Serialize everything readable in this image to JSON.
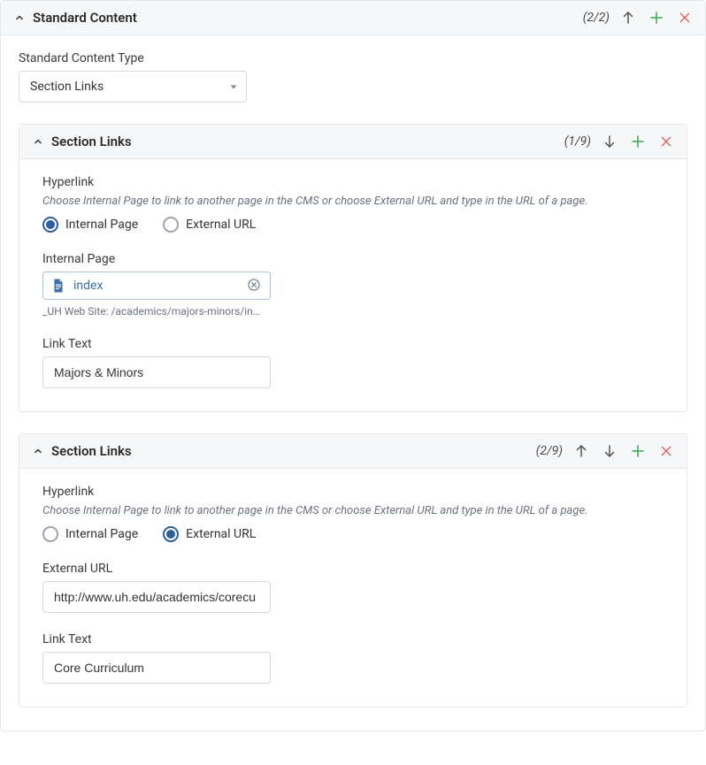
{
  "standard_content": {
    "title": "Standard Content",
    "count": "(2/2)",
    "type_label": "Standard Content Type",
    "type_value": "Section Links"
  },
  "section_links": [
    {
      "title": "Section Links",
      "count": "(1/9)",
      "show_up": false,
      "show_down": true,
      "hyperlink_label": "Hyperlink",
      "hyperlink_help": "Choose Internal Page to link to another page in the CMS or choose External URL and type in the URL of a page.",
      "radio_internal": "Internal Page",
      "radio_external": "External URL",
      "selected": "internal",
      "internal_page_label": "Internal Page",
      "internal_page_value": "index",
      "internal_page_path": "_UH Web Site: /academics/majors-minors/in…",
      "external_url_label": "External URL",
      "external_url_value": "",
      "link_text_label": "Link Text",
      "link_text_value": "Majors & Minors"
    },
    {
      "title": "Section Links",
      "count": "(2/9)",
      "show_up": true,
      "show_down": true,
      "hyperlink_label": "Hyperlink",
      "hyperlink_help": "Choose Internal Page to link to another page in the CMS or choose External URL and type in the URL of a page.",
      "radio_internal": "Internal Page",
      "radio_external": "External URL",
      "selected": "external",
      "internal_page_label": "Internal Page",
      "internal_page_value": "",
      "internal_page_path": "",
      "external_url_label": "External URL",
      "external_url_value": "http://www.uh.edu/academics/corecu",
      "link_text_label": "Link Text",
      "link_text_value": "Core Curriculum"
    }
  ]
}
